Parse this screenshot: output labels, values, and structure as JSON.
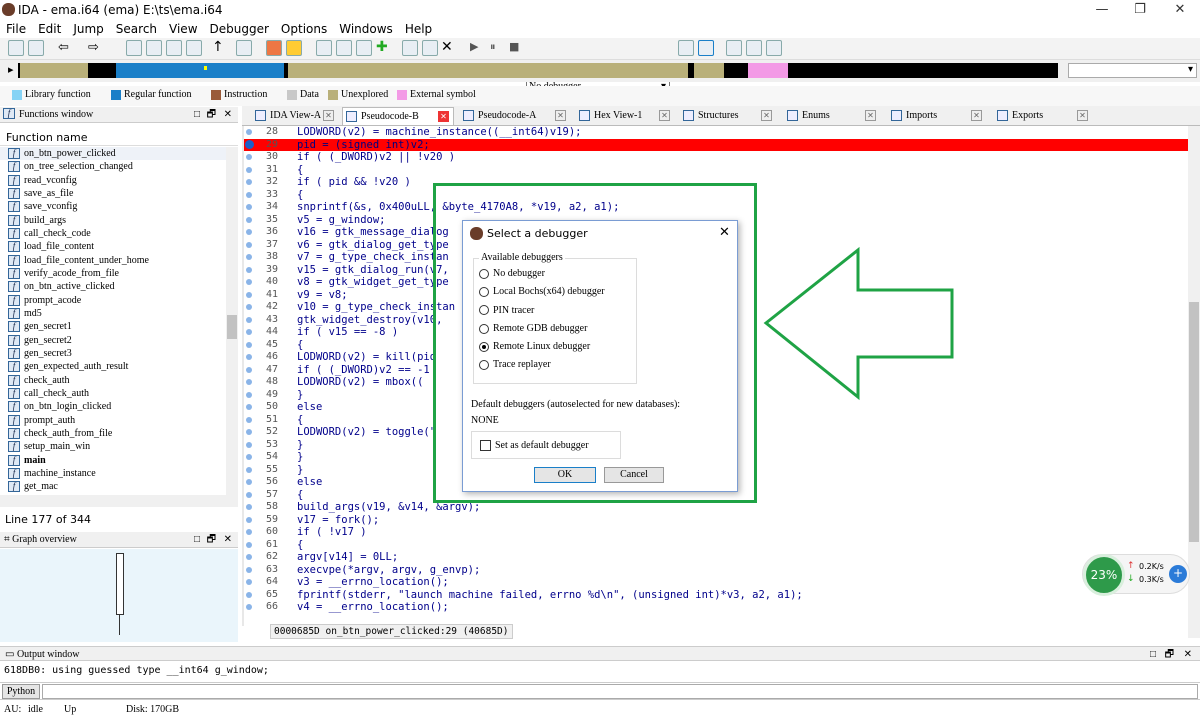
{
  "window": {
    "title": "IDA - ema.i64 (ema) E:\\ts\\ema.i64",
    "min": "—",
    "max": "❐",
    "close": "✕"
  },
  "menu": [
    "File",
    "Edit",
    "Jump",
    "Search",
    "View",
    "Debugger",
    "Options",
    "Windows",
    "Help"
  ],
  "toolbar": {
    "debugger_select": "No debugger"
  },
  "legend": [
    {
      "label": "Library function",
      "color": "#86d3f5"
    },
    {
      "label": "Regular function",
      "color": "#1a7fc8"
    },
    {
      "label": "Instruction",
      "color": "#9a5b3a"
    },
    {
      "label": "Data",
      "color": "#c8c8c8"
    },
    {
      "label": "Unexplored",
      "color": "#b9b07a"
    },
    {
      "label": "External symbol",
      "color": "#f39ae6"
    }
  ],
  "functions_panel": {
    "title": "Functions window",
    "column": "Function name",
    "status": "Line 177 of 344",
    "items": [
      "on_btn_power_clicked",
      "on_tree_selection_changed",
      "read_vconfig",
      "save_as_file",
      "save_vconfig",
      "build_args",
      "call_check_code",
      "load_file_content",
      "load_file_content_under_home",
      "verify_acode_from_file",
      "on_btn_active_clicked",
      "prompt_acode",
      "md5",
      "gen_secret1",
      "gen_secret2",
      "gen_secret3",
      "gen_expected_auth_result",
      "check_auth",
      "call_check_auth",
      "on_btn_login_clicked",
      "prompt_auth",
      "check_auth_from_file",
      "setup_main_win",
      "main",
      "machine_instance",
      "get_mac"
    ]
  },
  "graph_panel": {
    "title": "Graph overview"
  },
  "tabs": [
    {
      "label": "IDA View-A"
    },
    {
      "label": "Pseudocode-B"
    },
    {
      "label": "Pseudocode-A"
    },
    {
      "label": "Hex View-1"
    },
    {
      "label": "Structures"
    },
    {
      "label": "Enums"
    },
    {
      "label": "Imports"
    },
    {
      "label": "Exports"
    }
  ],
  "code": [
    {
      "n": "28",
      "t": "LODWORD(v2) = machine_instance((__int64)v19);"
    },
    {
      "n": "29",
      "t": "pid = (signed int)v2;"
    },
    {
      "n": "30",
      "t": "if ( (_DWORD)v2 || !v20 )"
    },
    {
      "n": "31",
      "t": "{"
    },
    {
      "n": "32",
      "t": "  if ( pid && !v20 )"
    },
    {
      "n": "33",
      "t": "  {"
    },
    {
      "n": "34",
      "t": "    snprintf(&s, 0x400uLL, &byte_4170A8, *v19, a2, a1);"
    },
    {
      "n": "35",
      "t": "    v5 = g_window;"
    },
    {
      "n": "36",
      "t": "    v16 = gtk_message_dialog"
    },
    {
      "n": "37",
      "t": "    v6 = gtk_dialog_get_type"
    },
    {
      "n": "38",
      "t": "    v7 = g_type_check_instan"
    },
    {
      "n": "39",
      "t": "    v15 = gtk_dialog_run(v7,"
    },
    {
      "n": "40",
      "t": "    v8 = gtk_widget_get_type"
    },
    {
      "n": "41",
      "t": "    v9 = v8;"
    },
    {
      "n": "42",
      "t": "    v10 = g_type_check_instan"
    },
    {
      "n": "43",
      "t": "    gtk_widget_destroy(v10,"
    },
    {
      "n": "44",
      "t": "    if ( v15 == -8 )"
    },
    {
      "n": "45",
      "t": "    {"
    },
    {
      "n": "46",
      "t": "      LODWORD(v2) = kill(pid"
    },
    {
      "n": "47",
      "t": "      if ( (_DWORD)v2 == -1"
    },
    {
      "n": "48",
      "t": "        LODWORD(v2) = mbox(("
    },
    {
      "n": "49",
      "t": "    }"
    },
    {
      "n": "50",
      "t": "    else"
    },
    {
      "n": "51",
      "t": "    {"
    },
    {
      "n": "52",
      "t": "      LODWORD(v2) = toggle(\""
    },
    {
      "n": "53",
      "t": "    }"
    },
    {
      "n": "54",
      "t": "  }"
    },
    {
      "n": "55",
      "t": "}"
    },
    {
      "n": "56",
      "t": "else"
    },
    {
      "n": "57",
      "t": "{"
    },
    {
      "n": "58",
      "t": "  build_args(v19, &v14, &argv);"
    },
    {
      "n": "59",
      "t": "  v17 = fork();"
    },
    {
      "n": "60",
      "t": "  if ( !v17 )"
    },
    {
      "n": "61",
      "t": "  {"
    },
    {
      "n": "62",
      "t": "    argv[v14] = 0LL;"
    },
    {
      "n": "63",
      "t": "    execvpe(*argv, argv, g_envp);"
    },
    {
      "n": "64",
      "t": "    v3 = __errno_location();"
    },
    {
      "n": "65",
      "t": "    fprintf(stderr, \"launch machine failed, errno %d\\n\", (unsigned int)*v3, a2, a1);"
    },
    {
      "n": "66",
      "t": "    v4 = __errno_location();"
    }
  ],
  "code_status": "0000685D on_btn_power_clicked:29 (40685D)",
  "dialog": {
    "title": "Select a debugger",
    "group": "Available debuggers",
    "options": [
      {
        "label": "No debugger",
        "on": false
      },
      {
        "label": "Local Bochs(x64) debugger",
        "on": false
      },
      {
        "label": "PIN tracer",
        "on": false
      },
      {
        "label": "Remote GDB debugger",
        "on": false
      },
      {
        "label": "Remote Linux debugger",
        "on": true
      },
      {
        "label": "Trace replayer",
        "on": false
      }
    ],
    "default_label": "Default debuggers (autoselected for new databases):",
    "default_value": "NONE",
    "checkbox": "Set as default debugger",
    "ok": "OK",
    "cancel": "Cancel"
  },
  "network": {
    "percent": "23%",
    "up": "0.2K/s",
    "down": "0.3K/s"
  },
  "output": {
    "title": "Output window",
    "line": "618DB0: using guessed type __int64 g_window;",
    "python": "Python"
  },
  "statusbar": {
    "au": "AU:",
    "state": "idle",
    "dir": "Up",
    "disk": "Disk: 170GB"
  }
}
